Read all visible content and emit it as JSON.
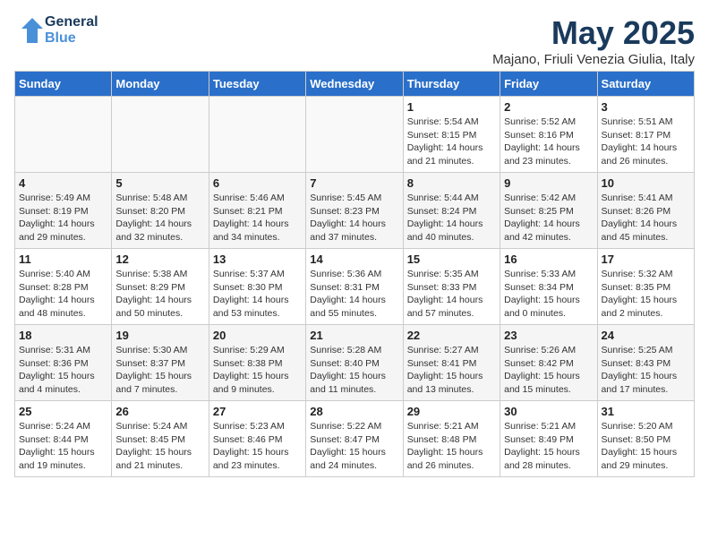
{
  "logo": {
    "line1": "General",
    "line2": "Blue"
  },
  "title": "May 2025",
  "subtitle": "Majano, Friuli Venezia Giulia, Italy",
  "days_of_week": [
    "Sunday",
    "Monday",
    "Tuesday",
    "Wednesday",
    "Thursday",
    "Friday",
    "Saturday"
  ],
  "weeks": [
    [
      {
        "day": "",
        "info": ""
      },
      {
        "day": "",
        "info": ""
      },
      {
        "day": "",
        "info": ""
      },
      {
        "day": "",
        "info": ""
      },
      {
        "day": "1",
        "info": "Sunrise: 5:54 AM\nSunset: 8:15 PM\nDaylight: 14 hours\nand 21 minutes."
      },
      {
        "day": "2",
        "info": "Sunrise: 5:52 AM\nSunset: 8:16 PM\nDaylight: 14 hours\nand 23 minutes."
      },
      {
        "day": "3",
        "info": "Sunrise: 5:51 AM\nSunset: 8:17 PM\nDaylight: 14 hours\nand 26 minutes."
      }
    ],
    [
      {
        "day": "4",
        "info": "Sunrise: 5:49 AM\nSunset: 8:19 PM\nDaylight: 14 hours\nand 29 minutes."
      },
      {
        "day": "5",
        "info": "Sunrise: 5:48 AM\nSunset: 8:20 PM\nDaylight: 14 hours\nand 32 minutes."
      },
      {
        "day": "6",
        "info": "Sunrise: 5:46 AM\nSunset: 8:21 PM\nDaylight: 14 hours\nand 34 minutes."
      },
      {
        "day": "7",
        "info": "Sunrise: 5:45 AM\nSunset: 8:23 PM\nDaylight: 14 hours\nand 37 minutes."
      },
      {
        "day": "8",
        "info": "Sunrise: 5:44 AM\nSunset: 8:24 PM\nDaylight: 14 hours\nand 40 minutes."
      },
      {
        "day": "9",
        "info": "Sunrise: 5:42 AM\nSunset: 8:25 PM\nDaylight: 14 hours\nand 42 minutes."
      },
      {
        "day": "10",
        "info": "Sunrise: 5:41 AM\nSunset: 8:26 PM\nDaylight: 14 hours\nand 45 minutes."
      }
    ],
    [
      {
        "day": "11",
        "info": "Sunrise: 5:40 AM\nSunset: 8:28 PM\nDaylight: 14 hours\nand 48 minutes."
      },
      {
        "day": "12",
        "info": "Sunrise: 5:38 AM\nSunset: 8:29 PM\nDaylight: 14 hours\nand 50 minutes."
      },
      {
        "day": "13",
        "info": "Sunrise: 5:37 AM\nSunset: 8:30 PM\nDaylight: 14 hours\nand 53 minutes."
      },
      {
        "day": "14",
        "info": "Sunrise: 5:36 AM\nSunset: 8:31 PM\nDaylight: 14 hours\nand 55 minutes."
      },
      {
        "day": "15",
        "info": "Sunrise: 5:35 AM\nSunset: 8:33 PM\nDaylight: 14 hours\nand 57 minutes."
      },
      {
        "day": "16",
        "info": "Sunrise: 5:33 AM\nSunset: 8:34 PM\nDaylight: 15 hours\nand 0 minutes."
      },
      {
        "day": "17",
        "info": "Sunrise: 5:32 AM\nSunset: 8:35 PM\nDaylight: 15 hours\nand 2 minutes."
      }
    ],
    [
      {
        "day": "18",
        "info": "Sunrise: 5:31 AM\nSunset: 8:36 PM\nDaylight: 15 hours\nand 4 minutes."
      },
      {
        "day": "19",
        "info": "Sunrise: 5:30 AM\nSunset: 8:37 PM\nDaylight: 15 hours\nand 7 minutes."
      },
      {
        "day": "20",
        "info": "Sunrise: 5:29 AM\nSunset: 8:38 PM\nDaylight: 15 hours\nand 9 minutes."
      },
      {
        "day": "21",
        "info": "Sunrise: 5:28 AM\nSunset: 8:40 PM\nDaylight: 15 hours\nand 11 minutes."
      },
      {
        "day": "22",
        "info": "Sunrise: 5:27 AM\nSunset: 8:41 PM\nDaylight: 15 hours\nand 13 minutes."
      },
      {
        "day": "23",
        "info": "Sunrise: 5:26 AM\nSunset: 8:42 PM\nDaylight: 15 hours\nand 15 minutes."
      },
      {
        "day": "24",
        "info": "Sunrise: 5:25 AM\nSunset: 8:43 PM\nDaylight: 15 hours\nand 17 minutes."
      }
    ],
    [
      {
        "day": "25",
        "info": "Sunrise: 5:24 AM\nSunset: 8:44 PM\nDaylight: 15 hours\nand 19 minutes."
      },
      {
        "day": "26",
        "info": "Sunrise: 5:24 AM\nSunset: 8:45 PM\nDaylight: 15 hours\nand 21 minutes."
      },
      {
        "day": "27",
        "info": "Sunrise: 5:23 AM\nSunset: 8:46 PM\nDaylight: 15 hours\nand 23 minutes."
      },
      {
        "day": "28",
        "info": "Sunrise: 5:22 AM\nSunset: 8:47 PM\nDaylight: 15 hours\nand 24 minutes."
      },
      {
        "day": "29",
        "info": "Sunrise: 5:21 AM\nSunset: 8:48 PM\nDaylight: 15 hours\nand 26 minutes."
      },
      {
        "day": "30",
        "info": "Sunrise: 5:21 AM\nSunset: 8:49 PM\nDaylight: 15 hours\nand 28 minutes."
      },
      {
        "day": "31",
        "info": "Sunrise: 5:20 AM\nSunset: 8:50 PM\nDaylight: 15 hours\nand 29 minutes."
      }
    ]
  ]
}
